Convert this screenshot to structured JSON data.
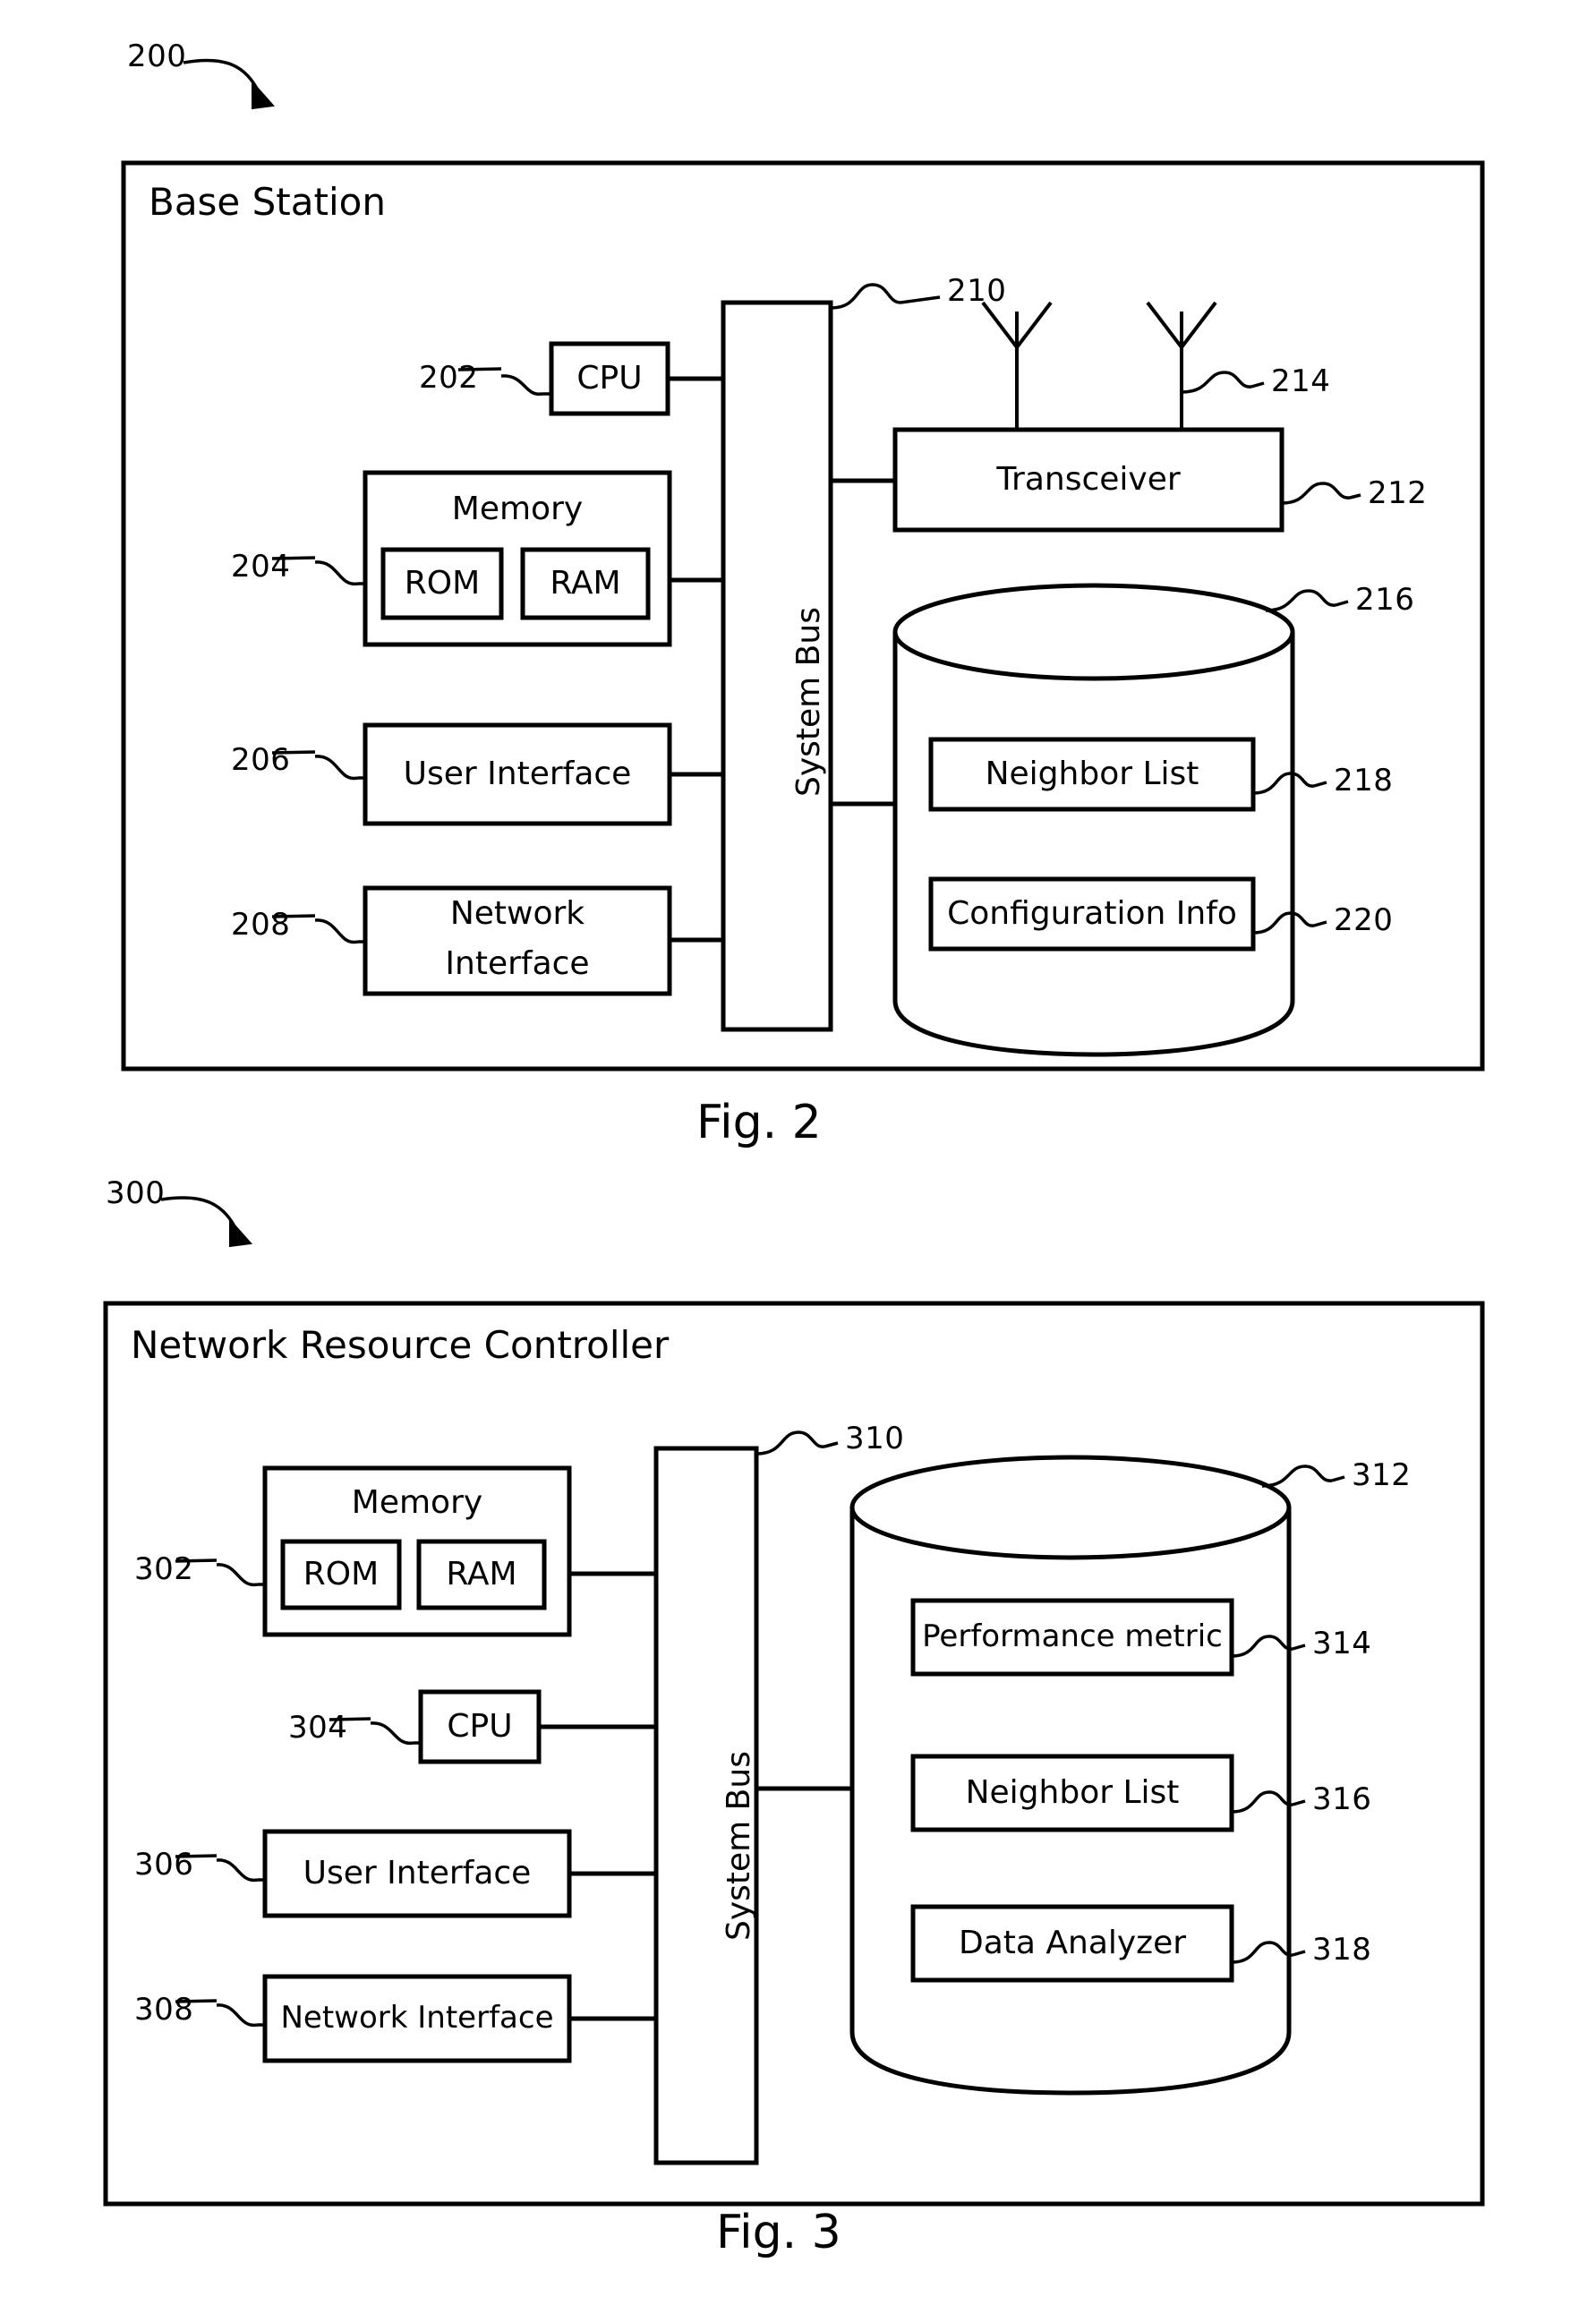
{
  "figures": [
    {
      "id": "fig2",
      "ref_number": "200",
      "panel_title": "Base Station",
      "caption": "Fig. 2",
      "bus_label": "System Bus",
      "bus_ref": "210",
      "blocks": [
        {
          "name": "cpu",
          "label": "CPU",
          "ref": "202"
        },
        {
          "name": "memory",
          "label": "Memory",
          "ref": "204"
        },
        {
          "name": "rom",
          "label": "ROM",
          "ref": ""
        },
        {
          "name": "ram",
          "label": "RAM",
          "ref": ""
        },
        {
          "name": "user-interface",
          "label": "User Interface",
          "ref": "206"
        },
        {
          "name": "network-interface",
          "label": "Network Interface",
          "ref": "208"
        },
        {
          "name": "transceiver",
          "label": "Transceiver",
          "ref": "212"
        },
        {
          "name": "antenna",
          "label": "",
          "ref": "214"
        },
        {
          "name": "database",
          "label": "",
          "ref": "216"
        },
        {
          "name": "neighbor-list",
          "label": "Neighbor List",
          "ref": "218"
        },
        {
          "name": "configuration-info",
          "label": "Configuration Info",
          "ref": "220"
        }
      ]
    },
    {
      "id": "fig3",
      "ref_number": "300",
      "panel_title": "Network Resource Controller",
      "caption": "Fig. 3",
      "bus_label": "System Bus",
      "bus_ref": "310",
      "blocks": [
        {
          "name": "memory",
          "label": "Memory",
          "ref": "302"
        },
        {
          "name": "rom",
          "label": "ROM",
          "ref": ""
        },
        {
          "name": "ram",
          "label": "RAM",
          "ref": ""
        },
        {
          "name": "cpu",
          "label": "CPU",
          "ref": "304"
        },
        {
          "name": "user-interface",
          "label": "User Interface",
          "ref": "306"
        },
        {
          "name": "network-interface",
          "label": "Network Interface",
          "ref": "308"
        },
        {
          "name": "database",
          "label": "",
          "ref": "312"
        },
        {
          "name": "performance-metric",
          "label": "Performance metric",
          "ref": "314"
        },
        {
          "name": "neighbor-list",
          "label": "Neighbor List",
          "ref": "316"
        },
        {
          "name": "data-analyzer",
          "label": "Data Analyzer",
          "ref": "318"
        }
      ]
    }
  ],
  "fig2": {
    "ref_number": "200",
    "panel_title": "Base Station",
    "caption": "Fig. 2",
    "bus_label": "System Bus",
    "bus_ref": "210",
    "cpu_label": "CPU",
    "cpu_ref": "202",
    "memory_label": "Memory",
    "memory_ref": "204",
    "rom_label": "ROM",
    "ram_label": "RAM",
    "ui_label": "User Interface",
    "ui_ref": "206",
    "ni_label_line1": "Network",
    "ni_label_line2": "Interface",
    "ni_ref": "208",
    "transceiver_label": "Transceiver",
    "transceiver_ref": "212",
    "antenna_ref": "214",
    "database_ref": "216",
    "neighbor_list_label": "Neighbor List",
    "neighbor_list_ref": "218",
    "config_info_label": "Configuration Info",
    "config_info_ref": "220"
  },
  "fig3": {
    "ref_number": "300",
    "panel_title": "Network Resource Controller",
    "caption": "Fig. 3",
    "bus_label": "System Bus",
    "bus_ref": "310",
    "memory_label": "Memory",
    "memory_ref": "302",
    "rom_label": "ROM",
    "ram_label": "RAM",
    "cpu_label": "CPU",
    "cpu_ref": "304",
    "ui_label": "User Interface",
    "ui_ref": "306",
    "ni_label": "Network Interface",
    "ni_ref": "308",
    "database_ref": "312",
    "performance_metric_label": "Performance metric",
    "performance_metric_ref": "314",
    "neighbor_list_label": "Neighbor List",
    "neighbor_list_ref": "316",
    "data_analyzer_label": "Data Analyzer",
    "data_analyzer_ref": "318"
  },
  "colors": {
    "ink": "#000000",
    "background": "#ffffff"
  }
}
